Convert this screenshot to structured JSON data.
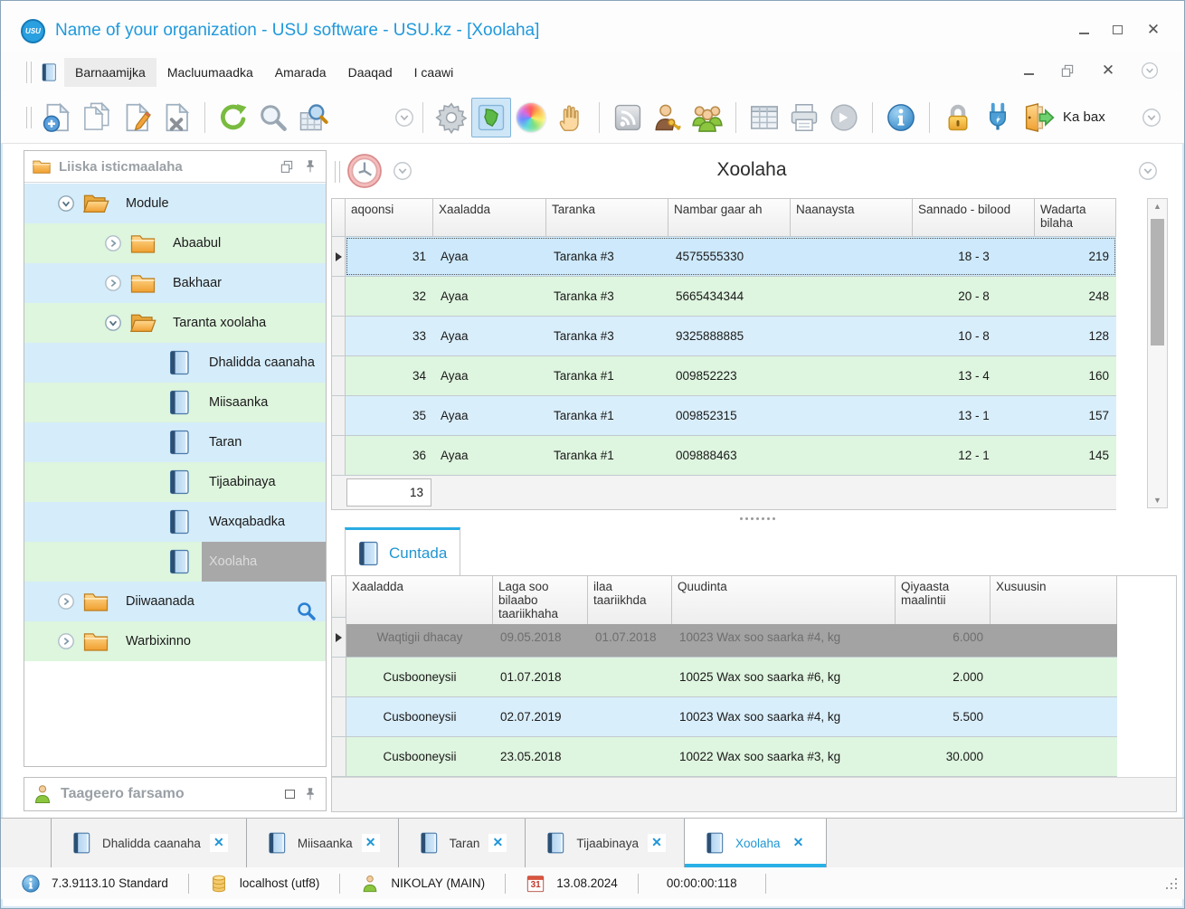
{
  "titlebar": {
    "title": "Name of your organization - USU software - USU.kz - [Xoolaha]",
    "logo_text": "USU"
  },
  "menubar": {
    "items": [
      "Barnaamijka",
      "Macluumaadka",
      "Amarada",
      "Daaqad",
      "I caawi"
    ]
  },
  "toolbar": {
    "exit_label": "Ka bax"
  },
  "sidebar": {
    "tree_header": "Liiska isticmaalaha",
    "support_header": "Taageero farsamo",
    "tree": [
      {
        "label": "Module",
        "type": "folder-open",
        "level": 0,
        "expanded": true
      },
      {
        "label": "Abaabul",
        "type": "folder",
        "level": 1,
        "expanded": false
      },
      {
        "label": "Bakhaar",
        "type": "folder",
        "level": 1,
        "expanded": false
      },
      {
        "label": "Taranta xoolaha",
        "type": "folder-open",
        "level": 1,
        "expanded": true
      },
      {
        "label": "Dhalidda caanaha",
        "type": "book",
        "level": 2
      },
      {
        "label": "Miisaanka",
        "type": "book",
        "level": 2
      },
      {
        "label": "Taran",
        "type": "book",
        "level": 2
      },
      {
        "label": "Tijaabinaya",
        "type": "book",
        "level": 2
      },
      {
        "label": "Waxqabadka",
        "type": "book",
        "level": 2
      },
      {
        "label": "Xoolaha",
        "type": "book",
        "level": 2,
        "selected": true
      },
      {
        "label": "Diiwaanada",
        "type": "folder",
        "level": 0,
        "expanded": false
      },
      {
        "label": "Warbixinno",
        "type": "folder",
        "level": 0,
        "expanded": false
      }
    ]
  },
  "main": {
    "title": "Xoolaha",
    "columns": [
      "aqoonsi",
      "Xaaladda",
      "Taranka",
      "Nambar gaar ah",
      "Naanaysta",
      "Sannado - bilood",
      "Wadarta bilaha"
    ],
    "rows": [
      [
        "31",
        "Ayaa",
        "Taranka #3",
        "4575555330",
        "",
        "18 - 3",
        "219"
      ],
      [
        "32",
        "Ayaa",
        "Taranka #3",
        "5665434344",
        "",
        "20 - 8",
        "248"
      ],
      [
        "33",
        "Ayaa",
        "Taranka #3",
        "9325888885",
        "",
        "10 - 8",
        "128"
      ],
      [
        "34",
        "Ayaa",
        "Taranka #1",
        "009852223",
        "",
        "13 - 4",
        "160"
      ],
      [
        "35",
        "Ayaa",
        "Taranka #1",
        "009852315",
        "",
        "13 - 1",
        "157"
      ],
      [
        "36",
        "Ayaa",
        "Taranka #1",
        "009888463",
        "",
        "12 - 1",
        "145"
      ]
    ],
    "footer_count": "13"
  },
  "detail": {
    "tab_label": "Cuntada",
    "columns": [
      "Xaaladda",
      "Laga soo bilaabo taariikhaha",
      "ilaa taariikhda",
      "Quudinta",
      "Qiyaasta maalintii",
      "Xusuusin"
    ],
    "rows": [
      [
        "Waqtigii dhacay",
        "09.05.2018",
        "01.07.2018",
        "10023 Wax soo saarka #4, kg",
        "6.000",
        ""
      ],
      [
        "Cusbooneysii",
        "01.07.2018",
        "",
        "10025 Wax soo saarka #6, kg",
        "2.000",
        ""
      ],
      [
        "Cusbooneysii",
        "02.07.2019",
        "",
        "10023 Wax soo saarka #4, kg",
        "5.500",
        ""
      ],
      [
        "Cusbooneysii",
        "23.05.2018",
        "",
        "10022 Wax soo saarka #3, kg",
        "30.000",
        ""
      ]
    ]
  },
  "bottom_tabs": [
    {
      "label": "Dhalidda caanaha",
      "active": false
    },
    {
      "label": "Miisaanka",
      "active": false
    },
    {
      "label": "Taran",
      "active": false
    },
    {
      "label": "Tijaabinaya",
      "active": false
    },
    {
      "label": "Xoolaha",
      "active": true
    }
  ],
  "statusbar": {
    "version": "7.3.9113.10 Standard",
    "database": "localhost (utf8)",
    "user": "NIKOLAY (MAIN)",
    "calendar_day": "31",
    "date": "13.08.2024",
    "timer": "00:00:00:118"
  },
  "colors": {
    "accent_blue": "#2196d3",
    "tab_underline": "#29abe2",
    "row_blue": "#d9eefb",
    "row_green": "#def5df",
    "selected_gray": "#a8a8a8"
  }
}
